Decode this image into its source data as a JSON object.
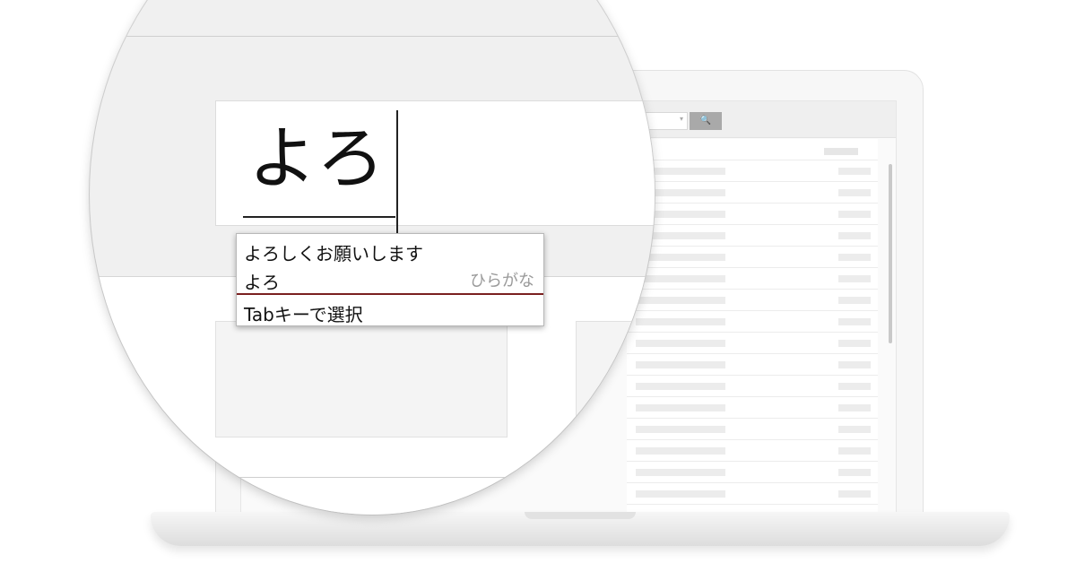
{
  "laptop_screen": {
    "search_button_icon": "search-icon",
    "list_rows": 16
  },
  "ime": {
    "composing_text": "よろ",
    "candidates": [
      {
        "text": "よろしくお願いします",
        "label": ""
      },
      {
        "text": "よろ",
        "label": "ひらがな"
      }
    ],
    "hint": "Tabキーで選択",
    "divider_color": "#7a1f1f"
  }
}
